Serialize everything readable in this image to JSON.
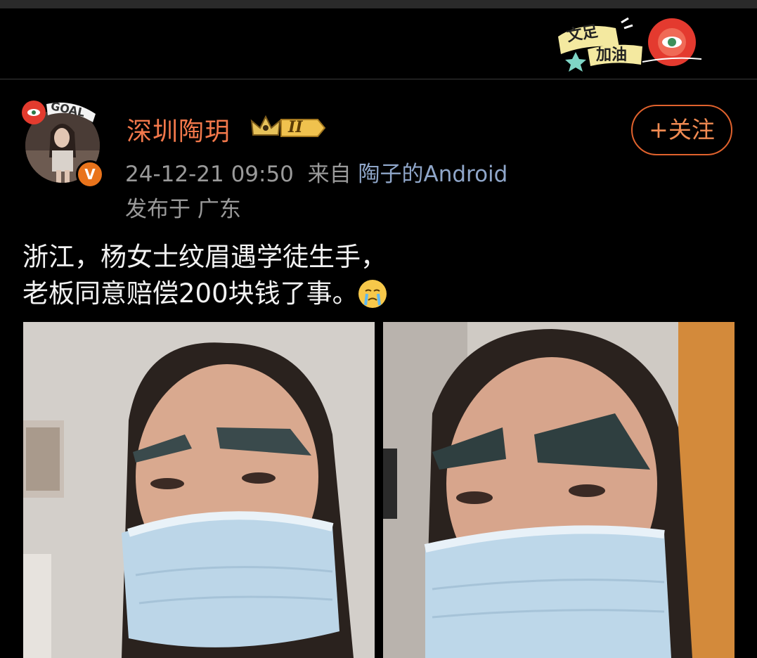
{
  "sticker": {
    "line1": "文足",
    "line2": "加油"
  },
  "post": {
    "username": "深圳陶玥",
    "rank_level": "II",
    "date_time": "24-12-21 09:50",
    "source_prefix": "来自",
    "source_device": "陶子的Android",
    "location": "发布于 广东",
    "follow_label": "+关注",
    "text_line1": "浙江，杨女士纹眉遇学徒生手，",
    "text_line2": "老板同意赔偿200块钱了事。",
    "avatar_sticker_text": "GOAL"
  },
  "colors": {
    "accent": "#f2784b",
    "badge": "#e9731b",
    "follow_border": "#e0622d",
    "source_link": "#8fa6c9"
  },
  "icons": [
    "rank-crown-icon",
    "verified-v-icon",
    "crying-emoji-icon",
    "eye-sticker-icon"
  ]
}
